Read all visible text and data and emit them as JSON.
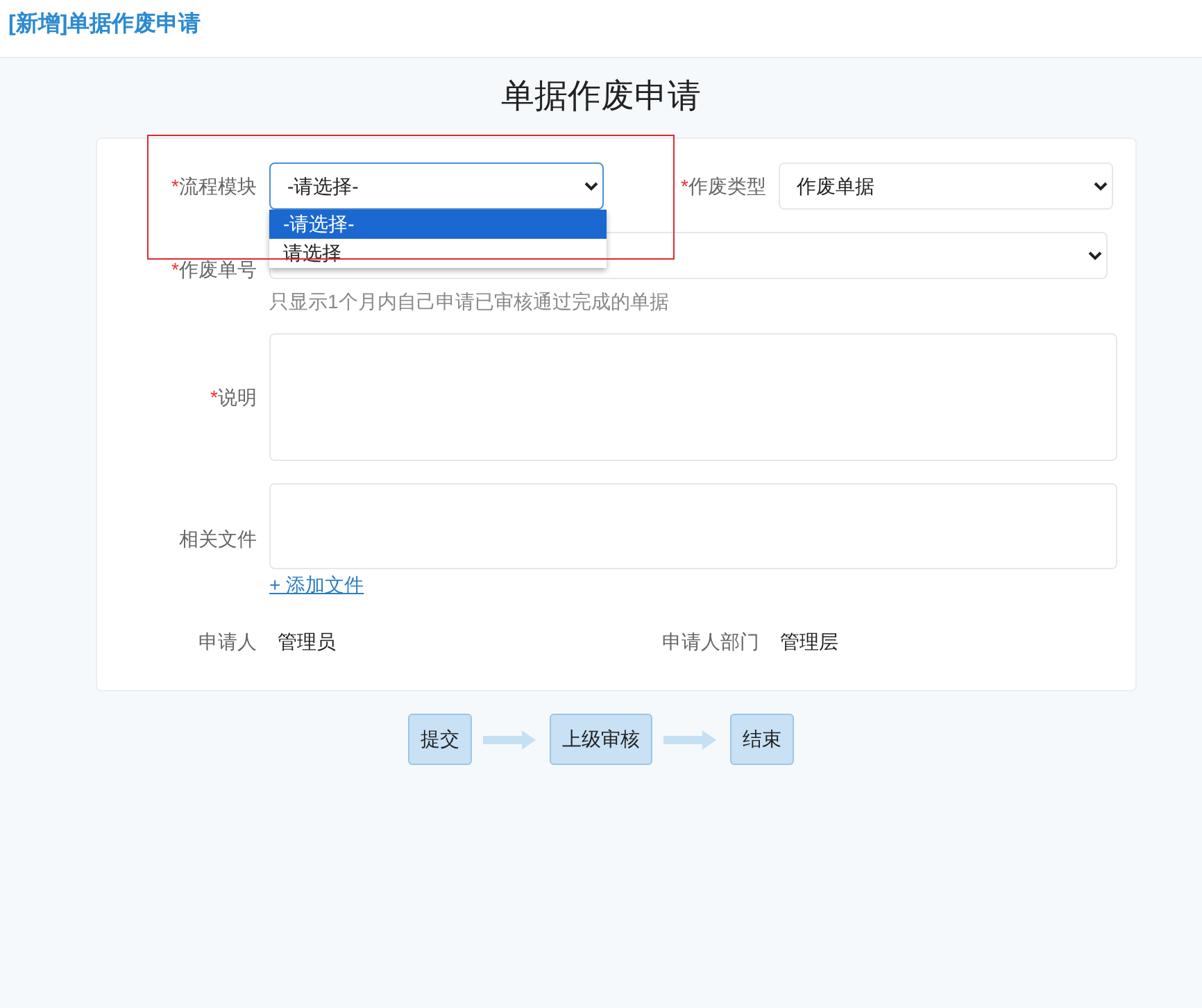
{
  "header": {
    "title": "[新增]单据作废申请"
  },
  "form": {
    "title": "单据作废申请",
    "flow_module": {
      "required_mark": "*",
      "label": "流程模块",
      "value": "-请选择-",
      "highlighted": true,
      "dropdown_open": true,
      "options": [
        {
          "label": "-请选择-",
          "selected": true
        },
        {
          "label": "请选择",
          "selected": false
        }
      ]
    },
    "void_type": {
      "required_mark": "*",
      "label": "作废类型",
      "value": "作废单据"
    },
    "void_number": {
      "required_mark": "*",
      "label": "作废单号",
      "hint": "只显示1个月内自己申请已审核通过完成的单据"
    },
    "description": {
      "required_mark": "*",
      "label": "说明"
    },
    "files": {
      "label": "相关文件",
      "add_link": "+ 添加文件"
    },
    "applicant": {
      "label": "申请人",
      "value": "管理员"
    },
    "department": {
      "label": "申请人部门",
      "value": "管理层"
    }
  },
  "steps": [
    {
      "label": "提交"
    },
    {
      "label": "上级审核"
    },
    {
      "label": "结束"
    }
  ]
}
